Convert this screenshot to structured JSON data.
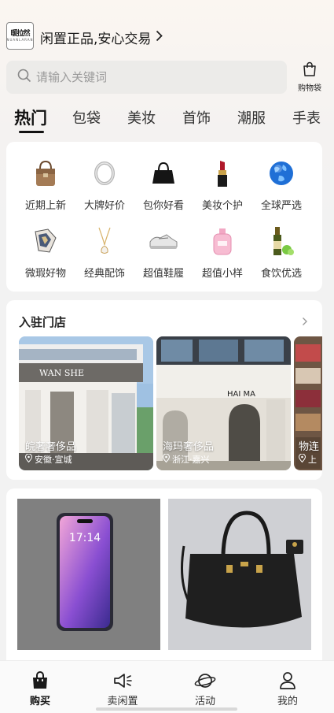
{
  "header": {
    "logo_line1": "暖拉然",
    "logo_line2": "NUANLARAN",
    "slogan": "闲置正品,安心交易"
  },
  "search": {
    "placeholder": "请输入关键词",
    "cart_label": "购物袋"
  },
  "tabs": [
    {
      "label": "热门",
      "active": true
    },
    {
      "label": "包袋"
    },
    {
      "label": "美妆"
    },
    {
      "label": "首饰"
    },
    {
      "label": "潮服"
    },
    {
      "label": "手表"
    }
  ],
  "categories": [
    {
      "label": "近期上新",
      "icon": "handbag-brown-icon"
    },
    {
      "label": "大牌好价",
      "icon": "bracelet-icon"
    },
    {
      "label": "包你好看",
      "icon": "black-bag-icon"
    },
    {
      "label": "美妆个护",
      "icon": "lipstick-icon"
    },
    {
      "label": "全球严选",
      "icon": "globe-icon"
    },
    {
      "label": "微瑕好物",
      "icon": "scarf-icon"
    },
    {
      "label": "经典配饰",
      "icon": "necklace-icon"
    },
    {
      "label": "超值鞋履",
      "icon": "sneaker-icon"
    },
    {
      "label": "超值小样",
      "icon": "perfume-icon"
    },
    {
      "label": "食饮优选",
      "icon": "wine-bottle-icon"
    }
  ],
  "stores": {
    "title": "入驻门店",
    "items": [
      {
        "name": "皖奢奢侈品",
        "location": "安徽·宣城",
        "sign": "WAN SHE"
      },
      {
        "name": "海玛奢侈品",
        "location": "浙江·嘉兴",
        "sign": "HAI MA"
      },
      {
        "name": "物连",
        "location": "上"
      }
    ]
  },
  "products": [
    {
      "image": "phone-photo",
      "clock": "17:14"
    },
    {
      "image": "black-handbag-photo"
    }
  ],
  "bottom_nav": [
    {
      "label": "购买",
      "icon": "shopping-bag-icon",
      "active": true
    },
    {
      "label": "卖闲置",
      "icon": "megaphone-icon"
    },
    {
      "label": "活动",
      "icon": "planet-icon"
    },
    {
      "label": "我的",
      "icon": "profile-icon"
    }
  ],
  "colors": {
    "accent": "#111111",
    "page_bg": "#f2f2f2"
  }
}
